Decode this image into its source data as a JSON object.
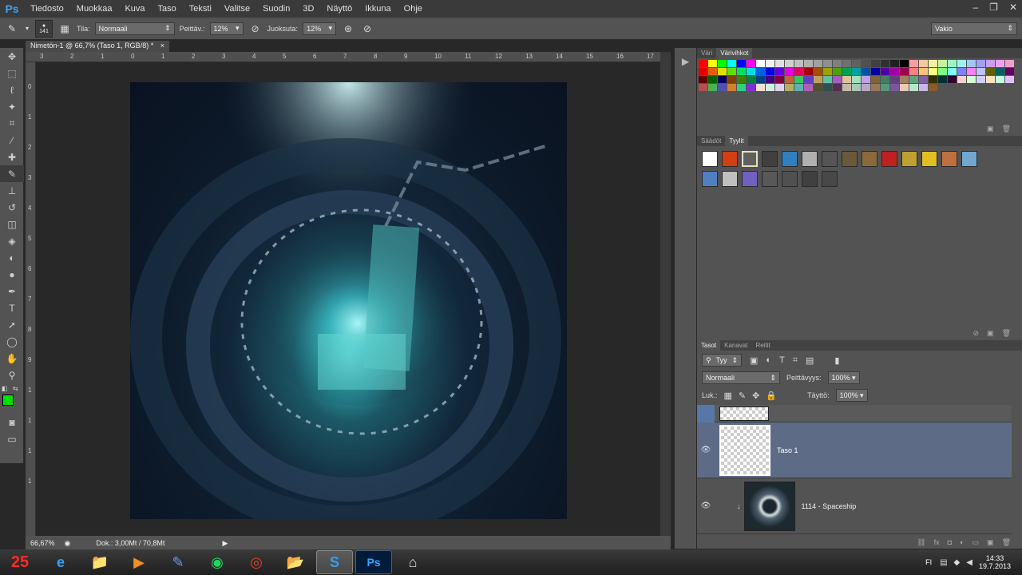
{
  "app": {
    "logo": "Ps",
    "menu": [
      "Tiedosto",
      "Muokkaa",
      "Kuva",
      "Taso",
      "Teksti",
      "Valitse",
      "Suodin",
      "3D",
      "Näyttö",
      "Ikkuna",
      "Ohje"
    ],
    "window_controls": [
      "–",
      "❐",
      "✕"
    ]
  },
  "options_bar": {
    "brush_size": "141",
    "mode_label": "Tila:",
    "mode_value": "Normaali",
    "opacity_label": "Peittäv.:",
    "opacity_value": "12%",
    "flow_label": "Juoksuta:",
    "flow_value": "12%",
    "workspace": "Vakio"
  },
  "document": {
    "tab_title": "Nimetön-1 @ 66,7% (Taso 1, RGB/8) *",
    "close": "×",
    "ruler_top": [
      "3",
      "2",
      "1",
      "0",
      "1",
      "2",
      "3",
      "4",
      "5",
      "6",
      "7",
      "8",
      "9",
      "10",
      "11",
      "12",
      "13",
      "14",
      "15",
      "16",
      "17"
    ],
    "ruler_left": [
      "0",
      "1",
      "2",
      "3",
      "4",
      "5",
      "6",
      "7",
      "8",
      "9",
      "1",
      "1",
      "1",
      "1"
    ],
    "zoom": "66,67%",
    "doc_info": "Dok.: 3,00Mt / 70,8Mt"
  },
  "colors_panel": {
    "tabs": [
      "Väri",
      "Värivihkot"
    ],
    "active_tab": 1,
    "swatches": [
      "#ff0000",
      "#ffff00",
      "#00ff00",
      "#00ffff",
      "#0000ff",
      "#ff00ff",
      "#ffffff",
      "#f0f0f0",
      "#e0e0e0",
      "#d0d0d0",
      "#c0c0c0",
      "#b0b0b0",
      "#a0a0a0",
      "#909090",
      "#808080",
      "#707070",
      "#606060",
      "#505050",
      "#404040",
      "#303030",
      "#202020",
      "#000000",
      "#f5a0a0",
      "#f5c8a0",
      "#f5f0a0",
      "#c8f0a0",
      "#a0f0c8",
      "#a0f0f0",
      "#a0c8f0",
      "#a0a0f0",
      "#c8a0f0",
      "#f0a0f0",
      "#f0a0c8",
      "#e00000",
      "#e06000",
      "#e0e000",
      "#60e000",
      "#00e060",
      "#00e0e0",
      "#0060e0",
      "#0000e0",
      "#6000e0",
      "#e000e0",
      "#e00060",
      "#a00000",
      "#a05000",
      "#a0a000",
      "#50a000",
      "#00a050",
      "#00a0a0",
      "#0050a0",
      "#0000a0",
      "#5000a0",
      "#a000a0",
      "#a00050",
      "#ff8080",
      "#ffc080",
      "#ffff80",
      "#80ff80",
      "#80ffff",
      "#8080ff",
      "#ff80ff",
      "#c0c0ff",
      "#606000",
      "#006060",
      "#600060",
      "#600000",
      "#006000",
      "#000060",
      "#804000",
      "#408000",
      "#008040",
      "#004080",
      "#400080",
      "#800040",
      "#c06040",
      "#40c060",
      "#6040c0",
      "#c0a060",
      "#60c0a0",
      "#a060c0",
      "#e0c0a0",
      "#a0e0c0",
      "#c0a0e0",
      "#806040",
      "#408060",
      "#604080",
      "#a08060",
      "#60a080",
      "#8060a0",
      "#303000",
      "#003030",
      "#300030",
      "#ffd0d0",
      "#d0ffd0",
      "#d0d0ff",
      "#ffe0c0",
      "#c0ffe0",
      "#e0c0ff",
      "#b05050",
      "#50b050",
      "#5050b0",
      "#d08030",
      "#30d080",
      "#8030d0",
      "#f0e0d0",
      "#d0f0e0",
      "#e0d0f0",
      "#b0b060",
      "#60b0b0",
      "#b060b0",
      "#505030",
      "#305050",
      "#503050",
      "#c8b8a8",
      "#a8c8b8",
      "#b8a8c8",
      "#987858",
      "#589878",
      "#785898",
      "#e8c8b8",
      "#b8e8c8",
      "#c8b8e8",
      "#8b5a2b"
    ]
  },
  "adjust_panel": {
    "tabs": [
      "Säädöt",
      "Tyylit"
    ],
    "active_tab": 1,
    "styles": [
      "#ffffff",
      "#d04010",
      "#606060",
      "#404040",
      "#3080c0",
      "#b0b0b0",
      "#555555",
      "#6a5a3a",
      "#8a6a3a",
      "#c02020",
      "#c0a030",
      "#e0c020",
      "#c07040",
      "#70a8d0",
      "#5080c0",
      "#c0c0c0",
      "#7060c0",
      "#585858",
      "#505050",
      "#404040",
      "#484848"
    ]
  },
  "layers_panel": {
    "tabs": [
      "Tasot",
      "Kanavat",
      "Reitit"
    ],
    "active_tab": 0,
    "filter_label": "Tyy",
    "blend_mode": "Normaali",
    "opacity_label": "Peittävyys:",
    "opacity_value": "100%",
    "lock_label": "Luk.:",
    "fill_label": "Täyttö:",
    "fill_value": "100%",
    "layers": [
      {
        "name": "Taso 1",
        "selected": true
      },
      {
        "name": "1114 - Spaceship",
        "selected": false
      }
    ]
  },
  "taskbar": {
    "apps": [
      "25",
      "e",
      "📁",
      "▶",
      "✎",
      "◉",
      "◎",
      "📂",
      "S",
      "Ps",
      "⌂"
    ],
    "tray_text": "FI",
    "time": "14:33",
    "date": "19.7.2013"
  }
}
